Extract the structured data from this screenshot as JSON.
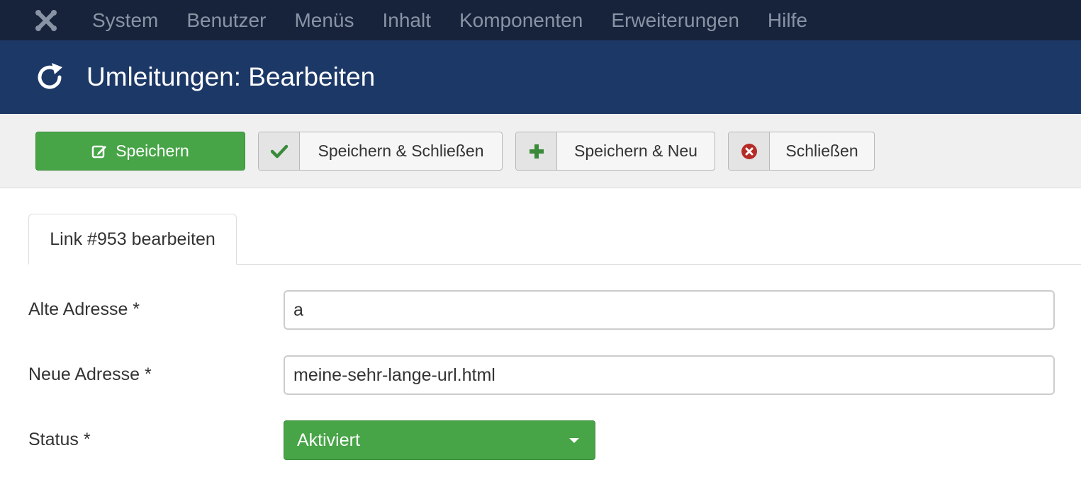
{
  "nav": {
    "items": [
      "System",
      "Benutzer",
      "Menüs",
      "Inhalt",
      "Komponenten",
      "Erweiterungen",
      "Hilfe"
    ]
  },
  "header": {
    "title": "Umleitungen: Bearbeiten",
    "icon": "refresh-icon"
  },
  "toolbar": {
    "save_label": "Speichern",
    "save_close_label": "Speichern & Schließen",
    "save_new_label": "Speichern & Neu",
    "close_label": "Schließen"
  },
  "tabs": {
    "active_label": "Link #953 bearbeiten"
  },
  "form": {
    "old_url_label": "Alte Adresse *",
    "old_url_value": "a",
    "new_url_label": "Neue Adresse *",
    "new_url_value": "meine-sehr-lange-url.html",
    "status_label": "Status *",
    "status_value": "Aktiviert"
  },
  "colors": {
    "navbar": "#17233b",
    "header": "#1c3867",
    "success": "#47a447",
    "danger": "#b52b27"
  }
}
